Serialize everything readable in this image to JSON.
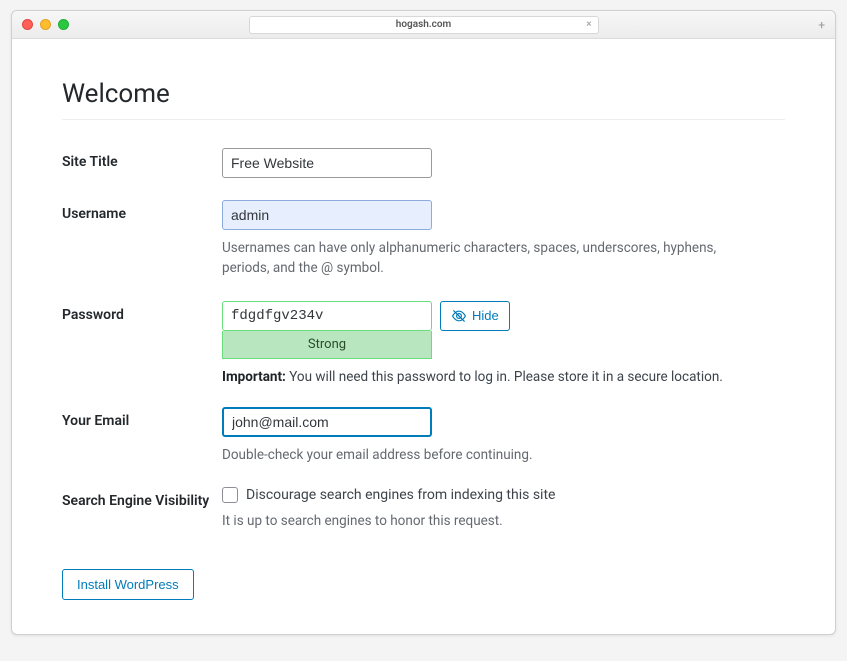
{
  "browser": {
    "url": "hogash.com"
  },
  "page": {
    "title": "Welcome"
  },
  "form": {
    "site_title": {
      "label": "Site Title",
      "value": "Free Website"
    },
    "username": {
      "label": "Username",
      "value": "admin",
      "hint": "Usernames can have only alphanumeric characters, spaces, underscores, hyphens, periods, and the @ symbol."
    },
    "password": {
      "label": "Password",
      "value": "fdgdfgv234v",
      "strength": "Strong",
      "hide_button": "Hide",
      "important_label": "Important:",
      "important_text": " You will need this password to log in. Please store it in a secure location."
    },
    "email": {
      "label": "Your Email",
      "value": "john@mail.com",
      "hint": "Double-check your email address before continuing."
    },
    "sev": {
      "label": "Search Engine Visibility",
      "checkbox_label": "Discourage search engines from indexing this site",
      "hint": "It is up to search engines to honor this request."
    },
    "submit": "Install WordPress"
  }
}
